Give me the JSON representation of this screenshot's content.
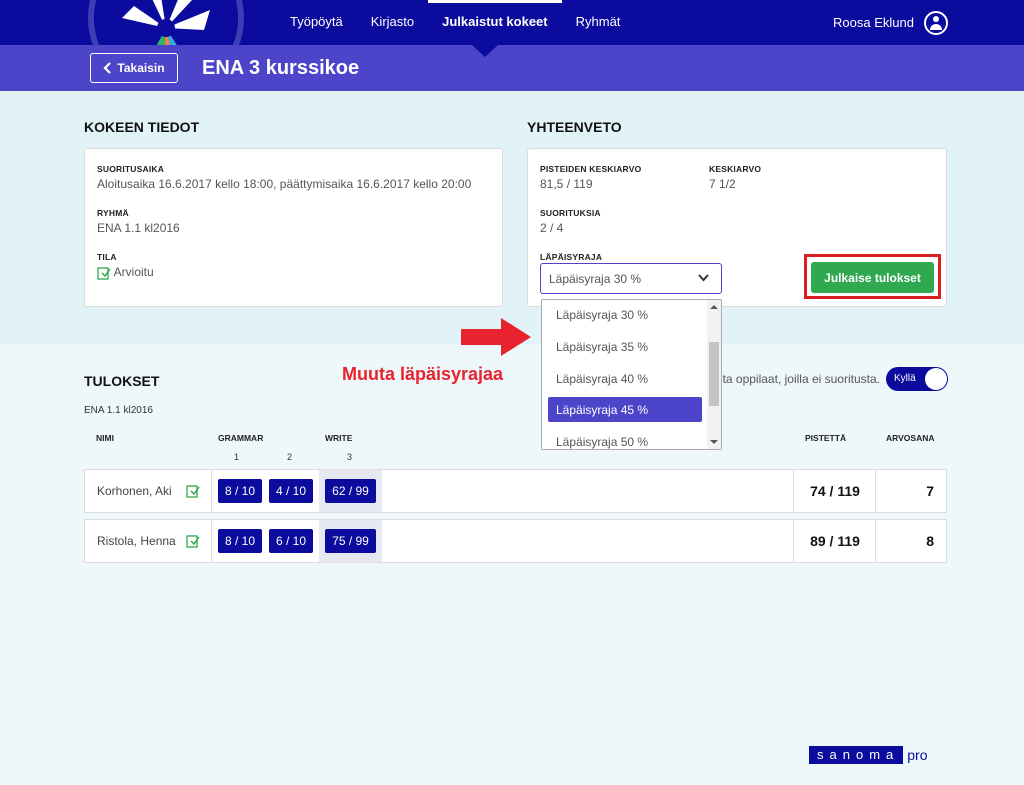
{
  "nav": {
    "items": [
      {
        "label": "Työpöytä"
      },
      {
        "label": "Kirjasto"
      },
      {
        "label": "Julkaistut kokeet"
      },
      {
        "label": "Ryhmät"
      }
    ],
    "active_index": 2,
    "user_name": "Roosa Eklund"
  },
  "header": {
    "back_label": "Takaisin",
    "title": "ENA 3 kurssikoe"
  },
  "details": {
    "title": "KOKEEN TIEDOT",
    "time_label": "SUORITUSAIKA",
    "time_value": "Aloitusaika 16.6.2017 kello 18:00, päättymisaika 16.6.2017 kello 20:00",
    "group_label": "RYHMÄ",
    "group_value": "ENA 1.1 kl2016",
    "status_label": "TILA",
    "status_value": "Arvioitu"
  },
  "summary": {
    "title": "YHTEENVETO",
    "avg_points_label": "PISTEIDEN KESKIARVO",
    "avg_points_value": "81,5 / 119",
    "avg_grade_label": "KESKIARVO",
    "avg_grade_value": "7 1/2",
    "submissions_label": "SUORITUKSIA",
    "submissions_value": "2 / 4",
    "pass_label": "LÄPÄISYRAJA",
    "pass_selected": "Läpäisyraja 30 %",
    "pass_options": [
      "Läpäisyraja 30 %",
      "Läpäisyraja 35 %",
      "Läpäisyraja 40 %",
      "Läpäisyraja 45 %",
      "Läpäisyraja 50 %"
    ],
    "highlighted_option_index": 3,
    "publish_label": "Julkaise tulokset"
  },
  "annotation": {
    "text": "Muuta läpäisyrajaa"
  },
  "results": {
    "title": "TULOKSET",
    "group": "ENA 1.1 kl2016",
    "toggle_text": "pta oppilaat, joilla ei suoritusta.",
    "toggle_label": "Kyllä",
    "col_name": "NIMI",
    "col_grammar": "GRAMMAR",
    "col_write": "WRITE",
    "col_points": "PISTETTÄ",
    "col_grade": "ARVOSANA",
    "task_numbers": [
      "1",
      "2",
      "3"
    ],
    "rows": [
      {
        "name": "Korhonen, Aki",
        "scores": [
          "8 / 10",
          "4 / 10",
          "62 / 99"
        ],
        "points": "74 / 119",
        "grade": "7"
      },
      {
        "name": "Ristola, Henna",
        "scores": [
          "8 / 10",
          "6 / 10",
          "75 / 99"
        ],
        "points": "89 / 119",
        "grade": "8"
      }
    ]
  },
  "brand": {
    "name": "sanoma",
    "suffix": "pro"
  },
  "colors": {
    "nav_bg": "#0b0b9e",
    "subbar_bg": "#4c44c9",
    "publish_green": "#2fa84f",
    "annotation_red": "#e8232f"
  }
}
